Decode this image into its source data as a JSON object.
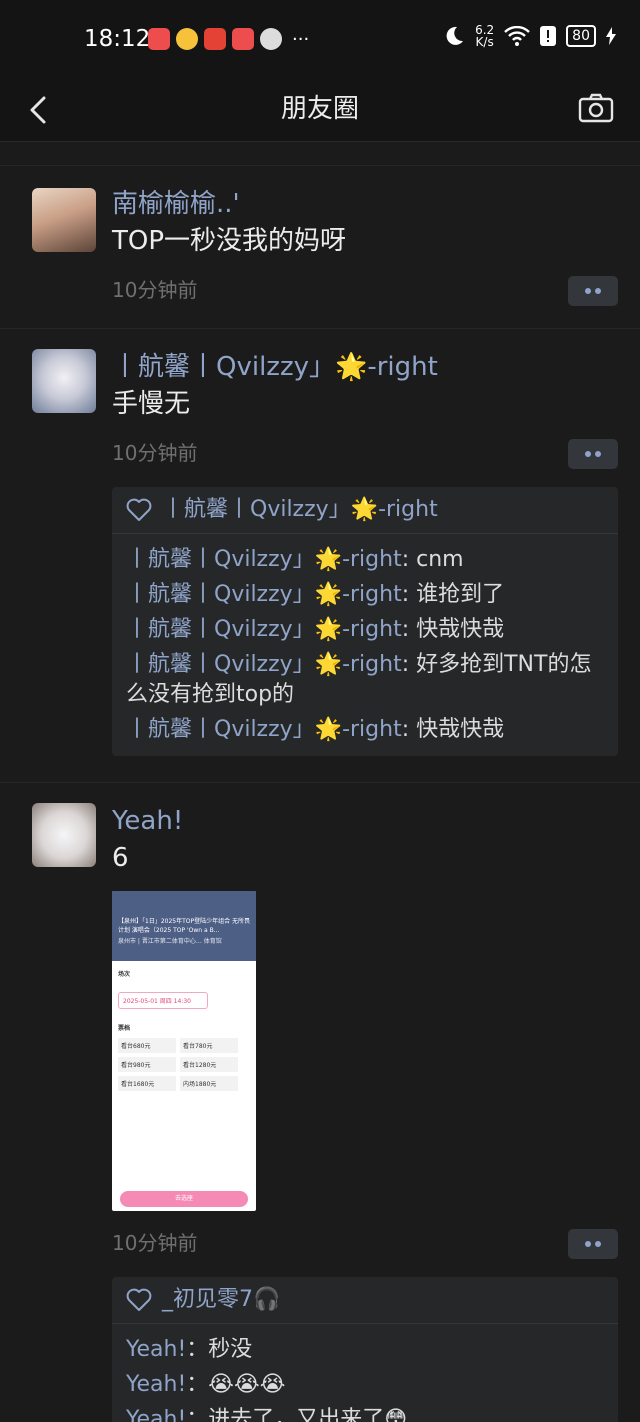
{
  "status_bar": {
    "time": "18:12",
    "speed_value": "6.2",
    "speed_unit": "K/s",
    "battery": "80",
    "more": "···"
  },
  "nav": {
    "title": "朋友圈"
  },
  "posts": [
    {
      "name": "南榆榆榆..'",
      "text": "TOP一秒没我的妈呀",
      "time": "10分钟前"
    },
    {
      "name": "丨航馨丨Qvilzzy」🌟-right",
      "text": "手慢无",
      "time": "10分钟前",
      "likes": "丨航馨丨Qvilzzy」🌟-right",
      "comments": [
        {
          "name": "丨航馨丨Qvilzzy」🌟-right",
          "text": ": cnm"
        },
        {
          "name": "丨航馨丨Qvilzzy」🌟-right",
          "text": ": 谁抢到了"
        },
        {
          "name": "丨航馨丨Qvilzzy」🌟-right",
          "text": ": 快哉快哉"
        },
        {
          "name": "丨航馨丨Qvilzzy」🌟-right",
          "text": ": 好多抢到TNT的怎么没有抢到top的"
        },
        {
          "name": "丨航馨丨Qvilzzy」🌟-right",
          "text": ": 快哉快哉"
        }
      ]
    },
    {
      "name": "Yeah!",
      "text": "6",
      "time": "10分钟前",
      "likes": "_初见零7🎧",
      "image": {
        "title": "【泉州】「1日」2025年TOP登陆少年组合 无所畏计划 演唱会（2025 TOP 'Own a B...",
        "venue": "泉州市 | 晋江市第二体育中心… 体育馆",
        "section1": "场次",
        "date": "2025-05-01 周四 14:30",
        "section2": "票档",
        "tiers": [
          "看台680元",
          "看台780元",
          "看台980元",
          "看台1280元",
          "看台1680元",
          "内场1880元"
        ],
        "button": "去选座"
      },
      "comments": [
        {
          "name": "Yeah!",
          "text": "：秒没"
        },
        {
          "name": "Yeah!",
          "text": "：😭😭😭"
        },
        {
          "name": "Yeah!",
          "text": "：进去了，又出来了😳"
        }
      ]
    }
  ],
  "colors": {
    "background": "#1b1b1b",
    "name_blue": "#8fa4c8",
    "timestamp_gray": "#6f6f6f",
    "comment_box": "#262729"
  }
}
